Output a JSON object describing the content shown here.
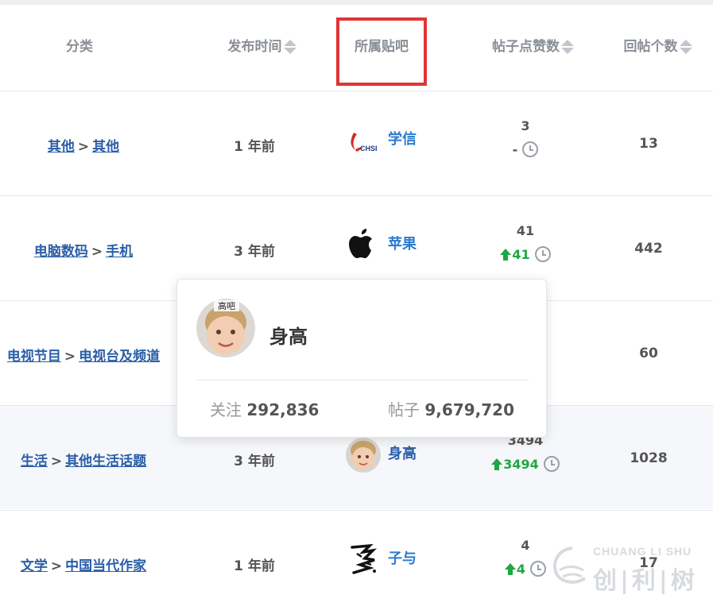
{
  "header": {
    "category": "分类",
    "publish_time": "发布时间",
    "tieba": "所属贴吧",
    "likes": "帖子点赞数",
    "replies": "回帖个数"
  },
  "rows": [
    {
      "cat1": "其他",
      "cat2": "其他",
      "time": "1 年前",
      "tieba": "学信",
      "icon": "chsi-logo-icon",
      "likes": "3",
      "delta": "-",
      "delta_type": "none",
      "replies": "13"
    },
    {
      "cat1": "电脑数码",
      "cat2": "手机",
      "time": "3 年前",
      "tieba": "苹果",
      "icon": "apple-logo-icon",
      "likes": "41",
      "delta": "41",
      "delta_type": "up",
      "replies": "442"
    },
    {
      "cat1": "电视节目",
      "cat2": "电视台及频道",
      "time": "",
      "tieba": "",
      "icon": "",
      "likes": "",
      "delta": "",
      "delta_type": "none",
      "replies": "60"
    },
    {
      "cat1": "生活",
      "cat2": "其他生活话题",
      "time": "3 年前",
      "tieba": "身高",
      "icon": "baby-avatar-icon",
      "likes": "3494",
      "delta": "3494",
      "delta_type": "up",
      "replies": "1028"
    },
    {
      "cat1": "文学",
      "cat2": "中国当代作家",
      "time": "1 年前",
      "tieba": "子与",
      "icon": "calligraphy-logo-icon",
      "likes": "4",
      "delta": "4",
      "delta_type": "up",
      "replies": "17"
    }
  ],
  "popup": {
    "name": "身高",
    "avatar_text": "高吧",
    "follow_label": "关注",
    "follow_count": "292,836",
    "posts_label": "帖子",
    "posts_count": "9,679,720"
  },
  "watermark": {
    "top": "CHUANG LI SHU",
    "bottom": "创|利|树"
  },
  "colors": {
    "link": "#2a5ea8",
    "tieba_link": "#2a7bd0",
    "up_green": "#1ea742",
    "highlight_red": "#e03535"
  }
}
